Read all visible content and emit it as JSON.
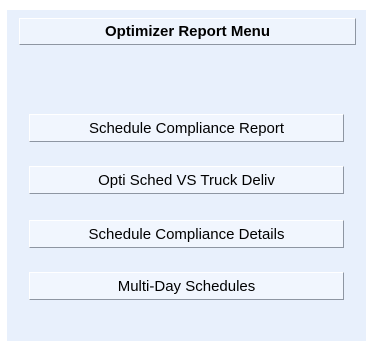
{
  "menu": {
    "title": "Optimizer Report Menu",
    "items": [
      {
        "label": "Schedule Compliance Report"
      },
      {
        "label": "Opti Sched VS Truck Deliv"
      },
      {
        "label": "Schedule Compliance Details"
      },
      {
        "label": "Multi-Day Schedules"
      }
    ]
  }
}
